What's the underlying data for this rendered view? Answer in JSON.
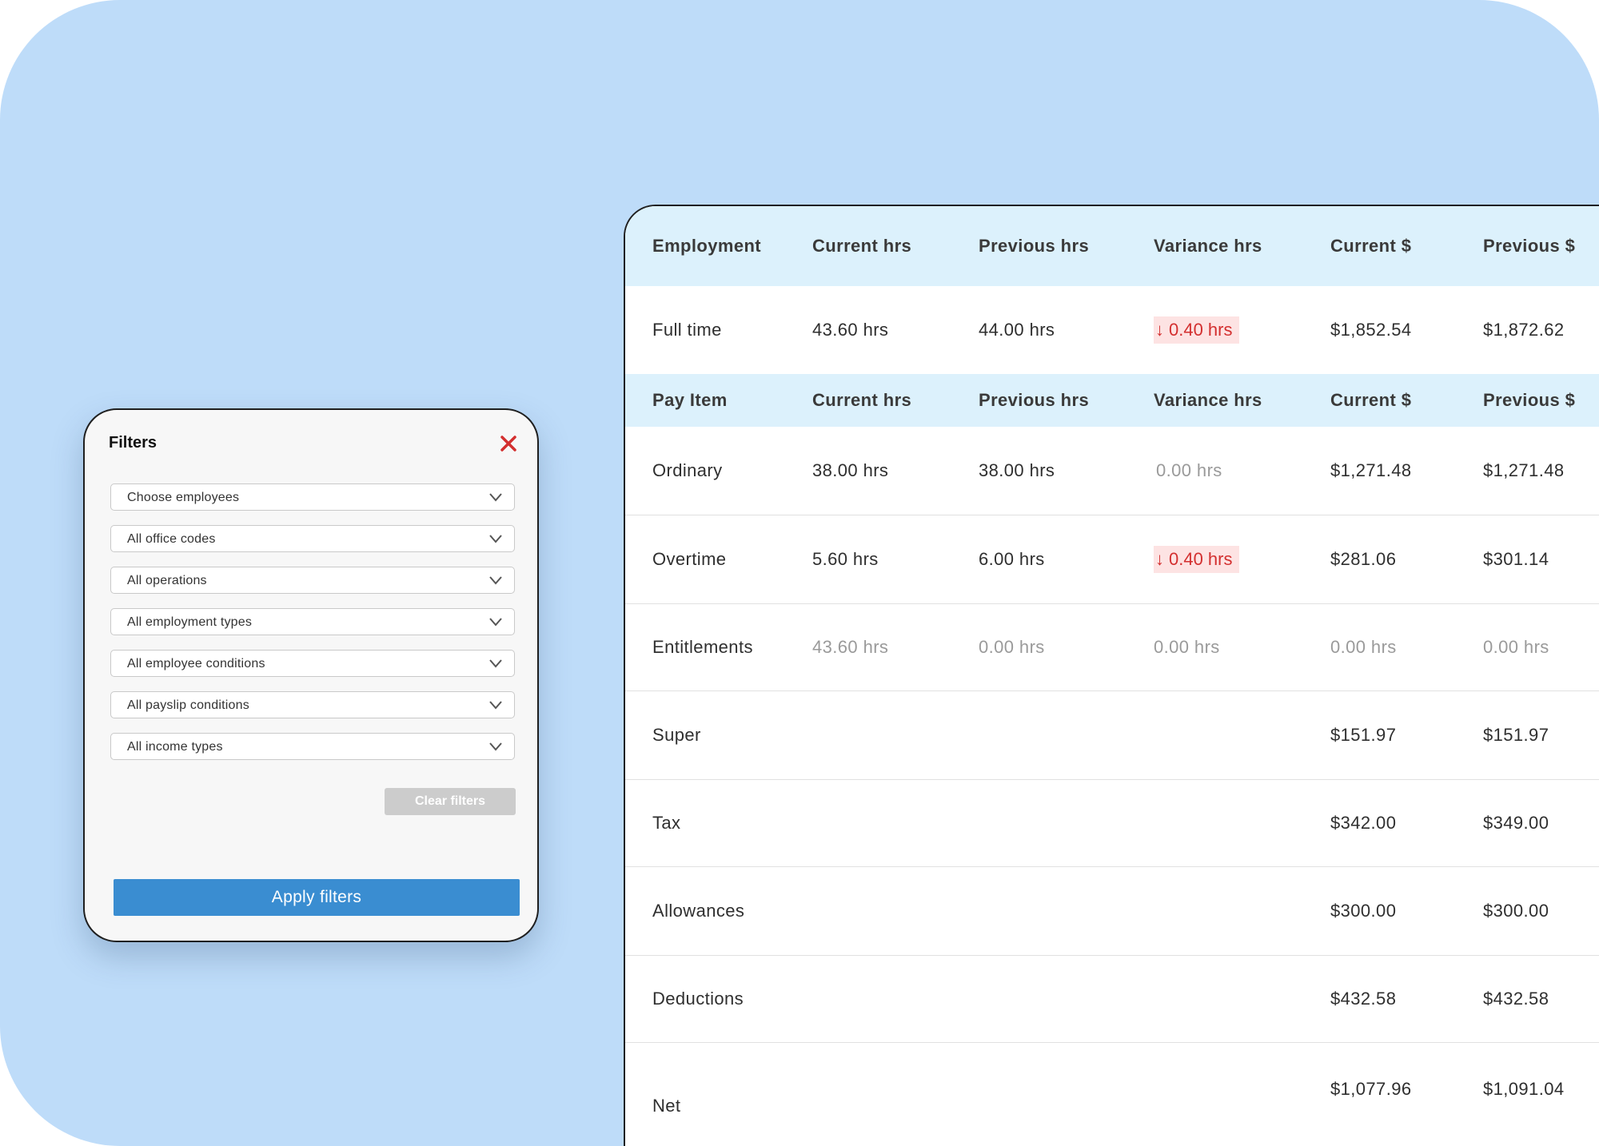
{
  "filters": {
    "title": "Filters",
    "selects": [
      "Choose employees",
      "All office codes",
      "All operations",
      "All employment types",
      "All employee conditions",
      "All payslip conditions",
      "All income types"
    ],
    "clear_label": "Clear filters",
    "apply_label": "Apply filters"
  },
  "report": {
    "employment_header": [
      "Employment",
      "Current hrs",
      "Previous hrs",
      "Variance hrs",
      "Current $",
      "Previous $"
    ],
    "employment_row": {
      "label": "Full time",
      "current_hrs": "43.60 hrs",
      "previous_hrs": "44.00 hrs",
      "variance_arrow": "↓",
      "variance_hrs": "0.40 hrs",
      "current_amount": "$1,852.54",
      "previous_amount": "$1,872.62"
    },
    "payitem_header": [
      "Pay Item",
      "Current hrs",
      "Previous hrs",
      "Variance hrs",
      "Current $",
      "Previous $"
    ],
    "rows": {
      "ordinary": {
        "label": "Ordinary",
        "current_hrs": "38.00 hrs",
        "previous_hrs": "38.00 hrs",
        "variance_hrs": "0.00 hrs",
        "current_amount": "$1,271.48",
        "previous_amount": "$1,271.48"
      },
      "overtime": {
        "label": "Overtime",
        "current_hrs": "5.60 hrs",
        "previous_hrs": "6.00 hrs",
        "variance_arrow": "↓",
        "variance_hrs": "0.40 hrs",
        "current_amount": "$281.06",
        "previous_amount": "$301.14"
      },
      "entitlements": {
        "label": "Entitlements",
        "current_hrs": "43.60 hrs",
        "previous_hrs": "0.00 hrs",
        "variance_hrs": "0.00 hrs",
        "current_amount": "0.00 hrs",
        "previous_amount": "0.00 hrs"
      },
      "super": {
        "label": "Super",
        "current_amount": "$151.97",
        "previous_amount": "$151.97"
      },
      "tax": {
        "label": "Tax",
        "current_amount": "$342.00",
        "previous_amount": "$349.00"
      },
      "allowances": {
        "label": "Allowances",
        "current_amount": "$300.00",
        "previous_amount": "$300.00"
      },
      "deductions": {
        "label": "Deductions",
        "current_amount": "$432.58",
        "previous_amount": "$432.58"
      },
      "net": {
        "label": "Net",
        "current_amount": "$1,077.96",
        "previous_amount": "$1,091.04"
      }
    }
  },
  "colors": {
    "background": "#bedcf9",
    "header_row": "#dcf1fc",
    "apply_button": "#3a8dd1",
    "negative_variance": "#d32f2f",
    "negative_variance_bg": "#fde3e3",
    "close_icon": "#d32f2f"
  },
  "icons": {
    "close": "close-icon",
    "dropdown": "chevron-down-icon",
    "variance_down": "arrow-down-icon"
  }
}
